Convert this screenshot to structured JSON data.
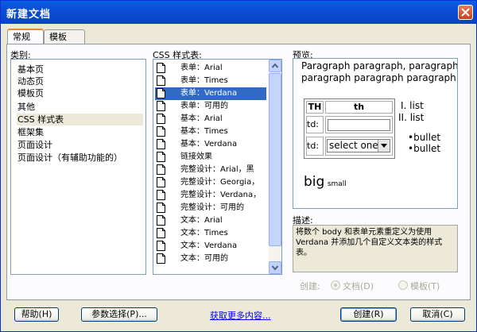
{
  "window": {
    "title": "新建文档"
  },
  "tabs": [
    {
      "label": "常规"
    },
    {
      "label": "模板"
    }
  ],
  "category": {
    "label": "类别:",
    "items": [
      "基本页",
      "动态页",
      "模板页",
      "其他",
      "CSS 样式表",
      "框架集",
      "页面设计",
      "页面设计（有辅助功能的）"
    ],
    "selected_index": 4
  },
  "css": {
    "label": "CSS 样式表:",
    "items": [
      "表单：Arial",
      "表单：Times",
      "表单：Verdana",
      "表单：可用的",
      "基本：Arial",
      "基本：Times",
      "基本：Verdana",
      "链接效果",
      "完整设计：Arial，黑",
      "完整设计：Georgia，",
      "完整设计：Verdana，",
      "完整设计：可用的",
      "文本：Arial",
      "文本：Times",
      "文本：Verdana",
      "文本：可用的"
    ],
    "selected_index": 2
  },
  "preview": {
    "label": "预览:",
    "para1": "Paragraph paragraph, paragraph",
    "para2": "paragraph paragraph paragraph",
    "th1": "TH",
    "th2": "th",
    "td1": "td:",
    "td2": "td:",
    "select_value": "select one",
    "ol": [
      "I. list",
      "II. list"
    ],
    "ul": [
      "bullet",
      "bullet"
    ],
    "big": "big",
    "small": "small"
  },
  "description": {
    "label": "描述:",
    "text": "将数个 body 和表单元素重定义为使用 Verdana 并添加几个自定义文本类的样式表。"
  },
  "create_as": {
    "label": "创建:",
    "doc_label": "文档(D)",
    "template_label": "模板(T)"
  },
  "buttons": {
    "help": "帮助(H)",
    "prefs": "参数选择(P)...",
    "more": "获取更多内容...",
    "create": "创建(R)",
    "cancel": "取消(C)"
  },
  "colors": {
    "titlebar": "#0a4fd6",
    "selection": "#316ac5",
    "face": "#ece9d8"
  }
}
